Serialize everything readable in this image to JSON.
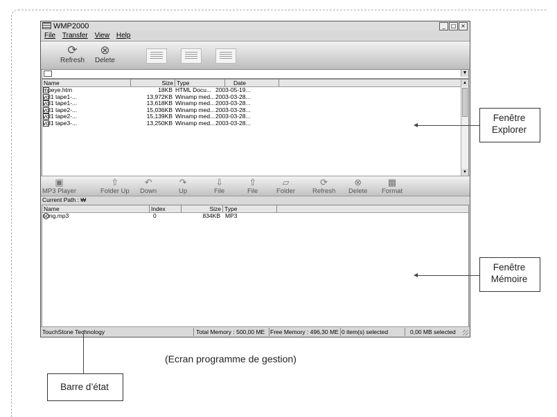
{
  "window": {
    "title": "WMP2000",
    "controls": [
      "_",
      "□",
      "×"
    ]
  },
  "menu": [
    "File",
    "Transfer",
    "View",
    "Help"
  ],
  "toolbar_top": {
    "refresh": "Refresh",
    "delete": "Delete"
  },
  "explorer": {
    "columns": [
      "Name",
      "Size",
      "Type",
      "Date"
    ],
    "rows": [
      {
        "name": "mpeye.htm",
        "size": "18KB",
        "type": "HTML Docu...",
        "date": "2003-05-19..."
      },
      {
        "name": "vol1 tape1-...",
        "size": "13,972KB",
        "type": "Winamp med...",
        "date": "2003-03-28..."
      },
      {
        "name": "vol1 tape1-...",
        "size": "13,618KB",
        "type": "Winamp med...",
        "date": "2003-03-28..."
      },
      {
        "name": "vol1 tape2-...",
        "size": "15,036KB",
        "type": "Winamp med...",
        "date": "2003-03-28..."
      },
      {
        "name": "vol1 tape2-...",
        "size": "15,139KB",
        "type": "Winamp med...",
        "date": "2003-03-28..."
      },
      {
        "name": "vol1 tape3-...",
        "size": "13,250KB",
        "type": "Winamp med...",
        "date": "2003-03-28..."
      }
    ]
  },
  "toolbar_device": {
    "mp3_player": "MP3 Player",
    "folder_up": "Folder Up",
    "down": "Down",
    "up": "Up",
    "file1": "File",
    "file2": "File",
    "folder": "Folder",
    "refresh": "Refresh",
    "delete": "Delete",
    "format": "Format"
  },
  "memory": {
    "current_path": "Current Path : ₩",
    "columns": [
      "Name",
      "Index",
      "Size",
      "Type"
    ],
    "rows": [
      {
        "name": "song.mp3",
        "index": "0",
        "size": "834KB",
        "type": "MP3"
      }
    ]
  },
  "status": {
    "company": "TouchStone Technology",
    "total_memory": "Total Memory : 500,00 ME",
    "free_memory": "Free Memory : 496,30 ME",
    "items_selected": "0 item(s) selected",
    "mb_selected": "0,00 MB selected"
  },
  "annotations": {
    "explorer_label_1": "Fenêtre",
    "explorer_label_2": "Explorer",
    "memory_label_1": "Fenêtre",
    "memory_label_2": "Mémoire",
    "status_label": "Barre d’état",
    "caption": "(Ecran programme de gestion)"
  }
}
